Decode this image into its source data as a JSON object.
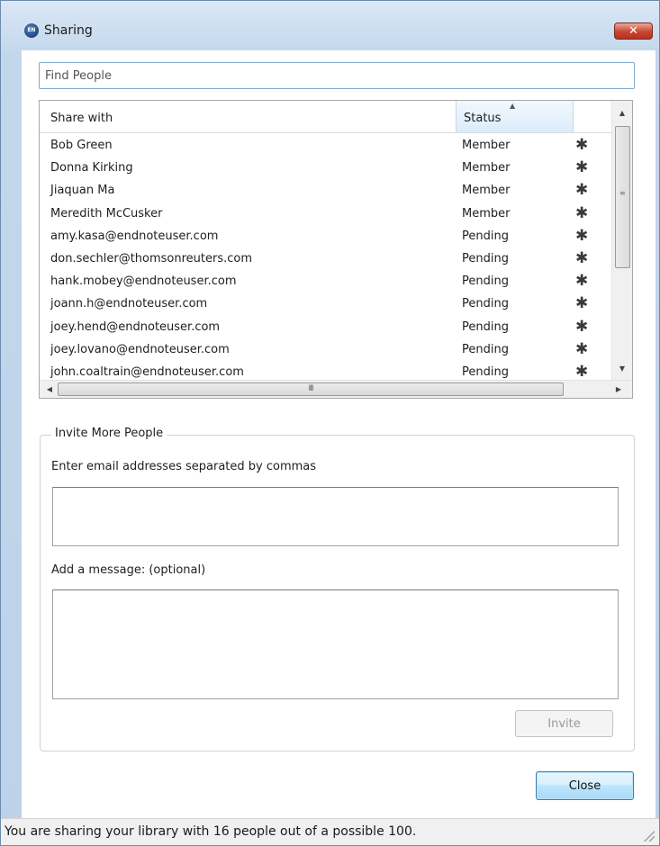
{
  "window": {
    "title": "Sharing",
    "app_icon_text": "EN",
    "close_glyph": "✕"
  },
  "find": {
    "placeholder": "Find People"
  },
  "members_table": {
    "columns": {
      "share_with": "Share with",
      "status": "Status"
    },
    "sort": {
      "column": "status",
      "direction": "ascending",
      "indicator": "▲"
    },
    "rows": [
      {
        "name": "Bob Green",
        "status": "Member",
        "action_icon": "gear-icon"
      },
      {
        "name": "Donna Kirking",
        "status": "Member",
        "action_icon": "gear-icon"
      },
      {
        "name": "Jiaquan Ma",
        "status": "Member",
        "action_icon": "gear-icon"
      },
      {
        "name": "Meredith McCusker",
        "status": "Member",
        "action_icon": "gear-icon"
      },
      {
        "name": "amy.kasa@endnoteuser.com",
        "status": "Pending",
        "action_icon": "gear-icon"
      },
      {
        "name": "don.sechler@thomsonreuters.com",
        "status": "Pending",
        "action_icon": "gear-icon"
      },
      {
        "name": "hank.mobey@endnoteuser.com",
        "status": "Pending",
        "action_icon": "gear-icon"
      },
      {
        "name": "joann.h@endnoteuser.com",
        "status": "Pending",
        "action_icon": "gear-icon"
      },
      {
        "name": "joey.hend@endnoteuser.com",
        "status": "Pending",
        "action_icon": "gear-icon"
      },
      {
        "name": "joey.lovano@endnoteuser.com",
        "status": "Pending",
        "action_icon": "gear-icon"
      },
      {
        "name": "john.coaltrain@endnoteuser.com",
        "status": "Pending",
        "action_icon": "gear-icon"
      }
    ],
    "scroll_glyphs": {
      "up": "▲",
      "down": "▼",
      "left": "◀",
      "right": "▶",
      "h_thumb_grip": "III",
      "v_thumb_grip": "≡"
    }
  },
  "invite": {
    "group_title": "Invite More People",
    "emails_label": "Enter email addresses separated by commas",
    "emails_value": "",
    "message_label": "Add a message: (optional)",
    "message_value": "",
    "invite_button": "Invite",
    "invite_enabled": false
  },
  "footer": {
    "close_button": "Close",
    "status_text": "You are sharing your library with 16 people out of a possible 100."
  },
  "colors": {
    "title_gradient_top": "#dbe8f5",
    "close_x_red": "#c9452f",
    "selected_header": "#dcecfb",
    "default_button_border": "#3c7fb1"
  }
}
